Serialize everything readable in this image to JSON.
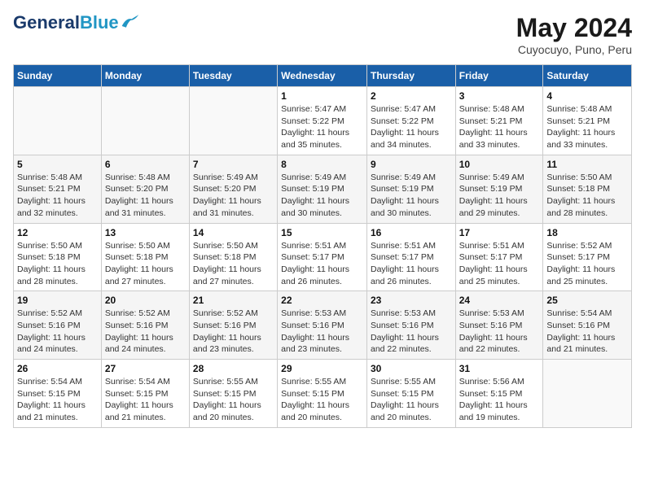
{
  "logo": {
    "line1": "General",
    "line2": "Blue"
  },
  "title": "May 2024",
  "subtitle": "Cuyocuyo, Puno, Peru",
  "days_of_week": [
    "Sunday",
    "Monday",
    "Tuesday",
    "Wednesday",
    "Thursday",
    "Friday",
    "Saturday"
  ],
  "weeks": [
    [
      {
        "day": "",
        "sunrise": "",
        "sunset": "",
        "daylight": ""
      },
      {
        "day": "",
        "sunrise": "",
        "sunset": "",
        "daylight": ""
      },
      {
        "day": "",
        "sunrise": "",
        "sunset": "",
        "daylight": ""
      },
      {
        "day": "1",
        "sunrise": "Sunrise: 5:47 AM",
        "sunset": "Sunset: 5:22 PM",
        "daylight": "Daylight: 11 hours and 35 minutes."
      },
      {
        "day": "2",
        "sunrise": "Sunrise: 5:47 AM",
        "sunset": "Sunset: 5:22 PM",
        "daylight": "Daylight: 11 hours and 34 minutes."
      },
      {
        "day": "3",
        "sunrise": "Sunrise: 5:48 AM",
        "sunset": "Sunset: 5:21 PM",
        "daylight": "Daylight: 11 hours and 33 minutes."
      },
      {
        "day": "4",
        "sunrise": "Sunrise: 5:48 AM",
        "sunset": "Sunset: 5:21 PM",
        "daylight": "Daylight: 11 hours and 33 minutes."
      }
    ],
    [
      {
        "day": "5",
        "sunrise": "Sunrise: 5:48 AM",
        "sunset": "Sunset: 5:21 PM",
        "daylight": "Daylight: 11 hours and 32 minutes."
      },
      {
        "day": "6",
        "sunrise": "Sunrise: 5:48 AM",
        "sunset": "Sunset: 5:20 PM",
        "daylight": "Daylight: 11 hours and 31 minutes."
      },
      {
        "day": "7",
        "sunrise": "Sunrise: 5:49 AM",
        "sunset": "Sunset: 5:20 PM",
        "daylight": "Daylight: 11 hours and 31 minutes."
      },
      {
        "day": "8",
        "sunrise": "Sunrise: 5:49 AM",
        "sunset": "Sunset: 5:19 PM",
        "daylight": "Daylight: 11 hours and 30 minutes."
      },
      {
        "day": "9",
        "sunrise": "Sunrise: 5:49 AM",
        "sunset": "Sunset: 5:19 PM",
        "daylight": "Daylight: 11 hours and 30 minutes."
      },
      {
        "day": "10",
        "sunrise": "Sunrise: 5:49 AM",
        "sunset": "Sunset: 5:19 PM",
        "daylight": "Daylight: 11 hours and 29 minutes."
      },
      {
        "day": "11",
        "sunrise": "Sunrise: 5:50 AM",
        "sunset": "Sunset: 5:18 PM",
        "daylight": "Daylight: 11 hours and 28 minutes."
      }
    ],
    [
      {
        "day": "12",
        "sunrise": "Sunrise: 5:50 AM",
        "sunset": "Sunset: 5:18 PM",
        "daylight": "Daylight: 11 hours and 28 minutes."
      },
      {
        "day": "13",
        "sunrise": "Sunrise: 5:50 AM",
        "sunset": "Sunset: 5:18 PM",
        "daylight": "Daylight: 11 hours and 27 minutes."
      },
      {
        "day": "14",
        "sunrise": "Sunrise: 5:50 AM",
        "sunset": "Sunset: 5:18 PM",
        "daylight": "Daylight: 11 hours and 27 minutes."
      },
      {
        "day": "15",
        "sunrise": "Sunrise: 5:51 AM",
        "sunset": "Sunset: 5:17 PM",
        "daylight": "Daylight: 11 hours and 26 minutes."
      },
      {
        "day": "16",
        "sunrise": "Sunrise: 5:51 AM",
        "sunset": "Sunset: 5:17 PM",
        "daylight": "Daylight: 11 hours and 26 minutes."
      },
      {
        "day": "17",
        "sunrise": "Sunrise: 5:51 AM",
        "sunset": "Sunset: 5:17 PM",
        "daylight": "Daylight: 11 hours and 25 minutes."
      },
      {
        "day": "18",
        "sunrise": "Sunrise: 5:52 AM",
        "sunset": "Sunset: 5:17 PM",
        "daylight": "Daylight: 11 hours and 25 minutes."
      }
    ],
    [
      {
        "day": "19",
        "sunrise": "Sunrise: 5:52 AM",
        "sunset": "Sunset: 5:16 PM",
        "daylight": "Daylight: 11 hours and 24 minutes."
      },
      {
        "day": "20",
        "sunrise": "Sunrise: 5:52 AM",
        "sunset": "Sunset: 5:16 PM",
        "daylight": "Daylight: 11 hours and 24 minutes."
      },
      {
        "day": "21",
        "sunrise": "Sunrise: 5:52 AM",
        "sunset": "Sunset: 5:16 PM",
        "daylight": "Daylight: 11 hours and 23 minutes."
      },
      {
        "day": "22",
        "sunrise": "Sunrise: 5:53 AM",
        "sunset": "Sunset: 5:16 PM",
        "daylight": "Daylight: 11 hours and 23 minutes."
      },
      {
        "day": "23",
        "sunrise": "Sunrise: 5:53 AM",
        "sunset": "Sunset: 5:16 PM",
        "daylight": "Daylight: 11 hours and 22 minutes."
      },
      {
        "day": "24",
        "sunrise": "Sunrise: 5:53 AM",
        "sunset": "Sunset: 5:16 PM",
        "daylight": "Daylight: 11 hours and 22 minutes."
      },
      {
        "day": "25",
        "sunrise": "Sunrise: 5:54 AM",
        "sunset": "Sunset: 5:16 PM",
        "daylight": "Daylight: 11 hours and 21 minutes."
      }
    ],
    [
      {
        "day": "26",
        "sunrise": "Sunrise: 5:54 AM",
        "sunset": "Sunset: 5:15 PM",
        "daylight": "Daylight: 11 hours and 21 minutes."
      },
      {
        "day": "27",
        "sunrise": "Sunrise: 5:54 AM",
        "sunset": "Sunset: 5:15 PM",
        "daylight": "Daylight: 11 hours and 21 minutes."
      },
      {
        "day": "28",
        "sunrise": "Sunrise: 5:55 AM",
        "sunset": "Sunset: 5:15 PM",
        "daylight": "Daylight: 11 hours and 20 minutes."
      },
      {
        "day": "29",
        "sunrise": "Sunrise: 5:55 AM",
        "sunset": "Sunset: 5:15 PM",
        "daylight": "Daylight: 11 hours and 20 minutes."
      },
      {
        "day": "30",
        "sunrise": "Sunrise: 5:55 AM",
        "sunset": "Sunset: 5:15 PM",
        "daylight": "Daylight: 11 hours and 20 minutes."
      },
      {
        "day": "31",
        "sunrise": "Sunrise: 5:56 AM",
        "sunset": "Sunset: 5:15 PM",
        "daylight": "Daylight: 11 hours and 19 minutes."
      },
      {
        "day": "",
        "sunrise": "",
        "sunset": "",
        "daylight": ""
      }
    ]
  ]
}
